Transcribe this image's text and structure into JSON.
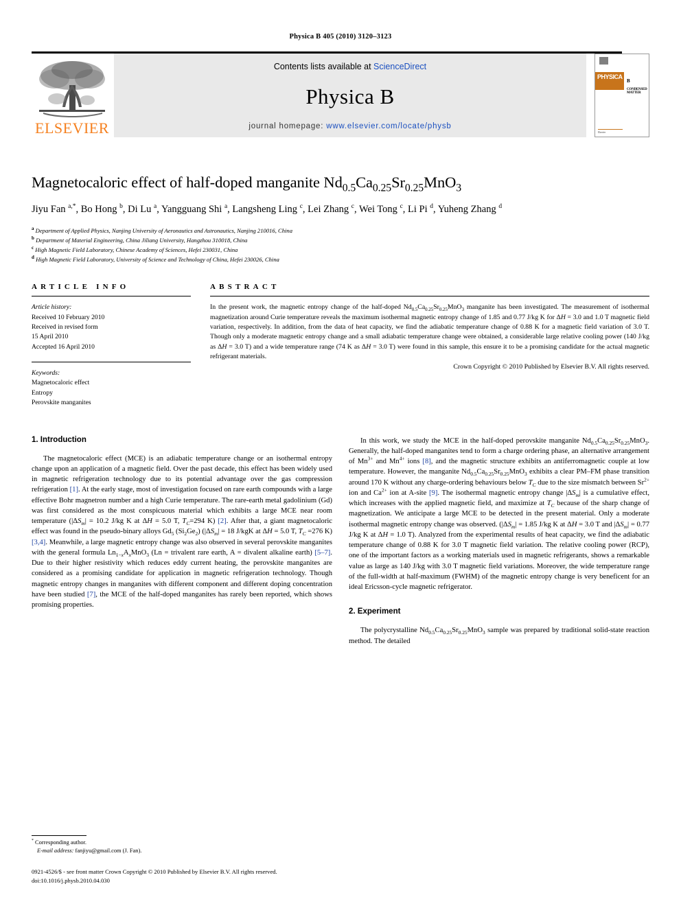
{
  "running_head": "Physica B 405 (2010) 3120–3123",
  "masthead": {
    "contents_prefix": "Contents lists available at ",
    "contents_link": "ScienceDirect",
    "journal_title": "Physica B",
    "homepage_prefix": "journal homepage: ",
    "homepage_url": "www.elsevier.com/locate/physb",
    "publisher_wordmark": "ELSEVIER",
    "publisher_color": "#F5801F",
    "link_color": "#1a4fbf",
    "cover": {
      "brand": "PHYSICA",
      "volume_letter": "B",
      "subtitle": "CONDENSED MATTER",
      "band_color": "#C8741B",
      "footer_brand": "Elsevier"
    }
  },
  "article": {
    "title_html": "Magnetocaloric effect of half-doped manganite Nd<sub>0.5</sub>Ca<sub>0.25</sub>Sr<sub>0.25</sub>MnO<sub>3</sub>",
    "authors_html": "Jiyu Fan <sup>a,</sup><sup>*</sup>, Bo Hong <sup>b</sup>, Di Lu <sup>a</sup>, Yangguang Shi <sup>a</sup>, Langsheng Ling <sup>c</sup>, Lei Zhang <sup>c</sup>, Wei Tong <sup>c</sup>, Li Pi <sup>d</sup>, Yuheng Zhang <sup>d</sup>",
    "affiliations": [
      {
        "marker": "a",
        "text": "Department of Applied Physics, Nanjing University of Aeronautics and Astronautics, Nanjing 210016, China"
      },
      {
        "marker": "b",
        "text": "Department of Material Engineering, China Jiliang University, Hangzhou 310018, China"
      },
      {
        "marker": "c",
        "text": "High Magnetic Field Laboratory, Chinese Academy of Sciences, Hefei 230031, China"
      },
      {
        "marker": "d",
        "text": "High Magnetic Field Laboratory, University of Science and Technology of China, Hefei 230026, China"
      }
    ]
  },
  "article_info": {
    "heading": "ARTICLE INFO",
    "history_label": "Article history:",
    "history": [
      "Received 10 February 2010",
      "Received in revised form",
      "15 April 2010",
      "Accepted 16 April 2010"
    ],
    "keywords_label": "Keywords:",
    "keywords": [
      "Magnetocaloric effect",
      "Entropy",
      "Perovskite manganites"
    ]
  },
  "abstract": {
    "heading": "ABSTRACT",
    "body_html": "In the present work, the magnetic entropy change of the half-doped Nd<sub>0.5</sub>Ca<sub>0.25</sub>Sr<sub>0.25</sub>MnO<sub>3</sub> manganite has been investigated. The measurement of isothermal magnetization around Curie temperature reveals the maximum isothermal magnetic entropy change of 1.85 and 0.77 J/kg K for &Delta;<span class=\"it\">H</span> = 3.0 and 1.0 T magnetic field variation, respectively. In addition, from the data of heat capacity, we find the adiabatic temperature change of 0.88 K for a magnetic field variation of 3.0 T. Though only a moderate magnetic entropy change and a small adiabatic temperature change were obtained, a considerable large relative cooling power (140 J/kg as &Delta;<span class=\"it\">H</span> = 3.0 T) and a wide temperature range (74 K as &Delta;<span class=\"it\">H</span> = 3.0 T) were found in this sample, this ensure it to be a promising candidate for the actual magnetic refrigerant materials.",
    "copyright": "Crown Copyright &copy; 2010 Published by Elsevier B.V. All rights reserved."
  },
  "sections": {
    "introduction_heading": "1. Introduction",
    "introduction_html": "The magnetocaloric effect (MCE) is an adiabatic temperature change or an isothermal entropy change upon an application of a magnetic field. Over the past decade, this effect has been widely used in magnetic refrigeration technology due to its potential advantage over the gas compression refrigeration <span class=\"ref\">[1]</span>. At the early stage, most of investigation focused on rare earth compounds with a large effective Bohr magnetron number and a high Curie temperature. The rare-earth metal gadolinium (Gd) was first considered as the most conspicuous material which exhibits a large MCE near room temperature (|&Delta;<span class=\"it\">S<sub>m</sub></span>| = 10.2 J/kg K at &Delta;<span class=\"it\">H</span> = 5.0 T, <span class=\"it\">T<sub>C</sub></span>=294 K) <span class=\"ref\">[2]</span>. After that, a giant magnetocaloric effect was found in the pseudo-binary alloys Gd<sub>5</sub> (Si<sub>2</sub>Ge<sub>2</sub>) (|&Delta;<span class=\"it\">S<sub>m</sub></span>| = 18 J/kgK at &Delta;<span class=\"it\">H</span> = 5.0 T, <span class=\"it\">T<sub>C</sub></span> =276 K) <span class=\"ref\">[3,4]</span>. Meanwhile, a large magnetic entropy change was also observed in several perovskite manganites with the general formula Ln<sub>1&minus;<span class=\"it\">x</span></sub>A<sub><span class=\"it\">x</span></sub>MnO<sub>3</sub> (Ln = trivalent rare earth, A = divalent alkaline earth) <span class=\"ref\">[5&ndash;7]</span>. Due to their higher resistivity which reduces eddy current heating, the perovskite manganites are considered as a promising candidate for application in magnetic refrigeration technology. Though magnetic entropy changes in manganites with different component and different doping concentration have been studied <span class=\"ref\">[7]</span>, the MCE of the half-doped manganites has rarely been reported, which shows promising properties.",
    "work_html": "In this work, we study the MCE in the half-doped perovskite manganite Nd<sub>0.5</sub>Ca<sub>0.25</sub>Sr<sub>0.25</sub>MnO<sub>3</sub>. Generally, the half-doped manganites tend to form a charge ordering phase, an alternative arrangement of Mn<sup>3+</sup> and Mn<sup>4+</sup> ions <span class=\"ref\">[8]</span>, and the magnetic structure exhibits an antiferromagnetic couple at low temperature. However, the manganite Nd<sub>0.5</sub>Ca<sub>0.25</sub>Sr<sub>0.25</sub>MnO<sub>3</sub> exhibits a clear PM&ndash;FM phase transition around 170 K without any charge-ordering behaviours below <span class=\"it\">T<sub>C</sub></span> due to the size mismatch between Sr<sup>2+</sup> ion and Ca<sup>2+</sup> ion at A-site <span class=\"ref\">[9]</span>. The isothermal magnetic entropy change |&Delta;<span class=\"it\">S<sub>m</sub></span>| is a cumulative effect, which increases with the applied magnetic field, and maximize at <span class=\"it\">T<sub>C</sub></span> because of the sharp change of magnetization. We anticipate a large MCE to be detected in the present material. Only a moderate isothermal magnetic entropy change was observed. (|&Delta;<span class=\"it\">S<sub>m</sub></span>| = 1.85 J/kg K at &Delta;<span class=\"it\">H</span> = 3.0 T and |&Delta;<span class=\"it\">S<sub>m</sub></span>| = 0.77 J/kg K at &Delta;<span class=\"it\">H</span> = 1.0 T). Analyzed from the experimental results of heat capacity, we find the adiabatic temperature change of 0.88 K for 3.0 T magnetic field variation. The relative cooling power (RCP), one of the important factors as a working materials used in magnetic refrigerants, shows a remarkable value as large as 140 J/kg with 3.0 T magnetic field variations. Moreover, the wide temperature range of the full-width at half-maximum (FWHM) of the magnetic entropy change is very beneficent for an ideal Ericsson-cycle magnetic refrigerator.",
    "experiment_heading": "2. Experiment",
    "experiment_html": "The polycrystalline Nd<sub>0.5</sub>Ca<sub>0.25</sub>Sr<sub>0.25</sub>MnO<sub>3</sub> sample was prepared by traditional solid-state reaction method. The detailed"
  },
  "footer": {
    "corresponding_marker": "*",
    "corresponding_text": "Corresponding author.",
    "email_label": "E-mail address:",
    "email": "fanjiyu@gmail.com (J. Fan).",
    "issn_line": "0921-4526/$ - see front matter Crown Copyright © 2010 Published by Elsevier B.V. All rights reserved.",
    "doi_line": "doi:10.1016/j.physb.2010.04.030"
  }
}
